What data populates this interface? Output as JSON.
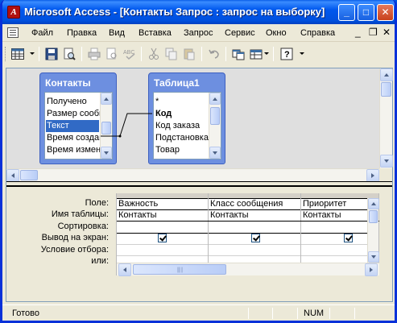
{
  "window": {
    "app_icon_letter": "A",
    "title": "Microsoft Access - [Контакты Запрос : запрос на выборку]",
    "minimize_glyph": "_",
    "maximize_glyph": "□",
    "close_glyph": "✕"
  },
  "menu": {
    "items": [
      {
        "label": "Файл"
      },
      {
        "label": "Правка"
      },
      {
        "label": "Вид"
      },
      {
        "label": "Вставка"
      },
      {
        "label": "Запрос"
      },
      {
        "label": "Сервис"
      },
      {
        "label": "Окно"
      },
      {
        "label": "Справка"
      }
    ],
    "doc_minimize": "_",
    "doc_restore": "❐",
    "doc_close": "✕"
  },
  "toolbar": {
    "icons": [
      "view-datasheet-icon",
      "save-icon",
      "search-icon",
      "print-icon",
      "print-preview-icon",
      "spellcheck-icon",
      "cut-icon",
      "copy-icon",
      "paste-icon",
      "undo-icon",
      "show-table-icon",
      "query-type-icon",
      "run-icon",
      "help-icon"
    ]
  },
  "tables": [
    {
      "title": "Контакты",
      "fields": [
        "Получено",
        "Размер сообщ",
        "Текст",
        "Время создан",
        "Время измене"
      ],
      "selected_index": 2
    },
    {
      "title": "Таблица1",
      "fields": [
        "*",
        "Код",
        "Код заказа",
        "Подстановка",
        "Товар"
      ],
      "bold_index": 1
    }
  ],
  "grid": {
    "row_labels": [
      "Поле:",
      "Имя таблицы:",
      "Сортировка:",
      "Вывод на экран:",
      "Условие отбора:",
      "или:"
    ],
    "columns": [
      {
        "field": "Важность",
        "table": "Контакты",
        "show": true
      },
      {
        "field": "Класс сообщения",
        "table": "Контакты",
        "show": true
      },
      {
        "field": "Приоритет",
        "table": "Контакты",
        "show": true
      }
    ]
  },
  "status": {
    "text": "Готово",
    "num": "NUM"
  },
  "colors": {
    "titlebar": "#0054e3",
    "fieldlist_header": "#6d8fe0",
    "selection": "#316ac5",
    "chrome": "#ece9d8"
  }
}
